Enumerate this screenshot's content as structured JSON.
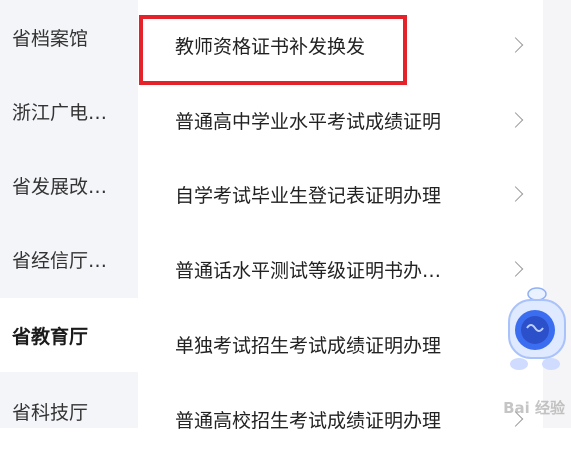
{
  "sidebar": {
    "items": [
      {
        "label": "省档案馆",
        "active": false
      },
      {
        "label": "浙江广电…",
        "active": false
      },
      {
        "label": "省发展改…",
        "active": false
      },
      {
        "label": "省经信厅…",
        "active": false
      },
      {
        "label": "省教育厅",
        "active": true
      },
      {
        "label": "省科技厅",
        "active": false
      }
    ]
  },
  "services": {
    "items": [
      {
        "label": "教师资格证书补发换发"
      },
      {
        "label": "普通高中学业水平考试成绩证明"
      },
      {
        "label": "自学考试毕业生登记表证明办理"
      },
      {
        "label": "普通话水平测试等级证明书办…"
      },
      {
        "label": "单独考试招生考试成绩证明办理"
      },
      {
        "label": "普通高校招生考试成绩证明办理"
      }
    ]
  },
  "assistant": {
    "icon": "robot-assistant-icon"
  },
  "watermark": {
    "text": "Bai 经验"
  },
  "colors": {
    "highlight": "#e5222a",
    "sidebar_bg": "#f4f5f9",
    "accent_blue": "#3b6df0"
  }
}
